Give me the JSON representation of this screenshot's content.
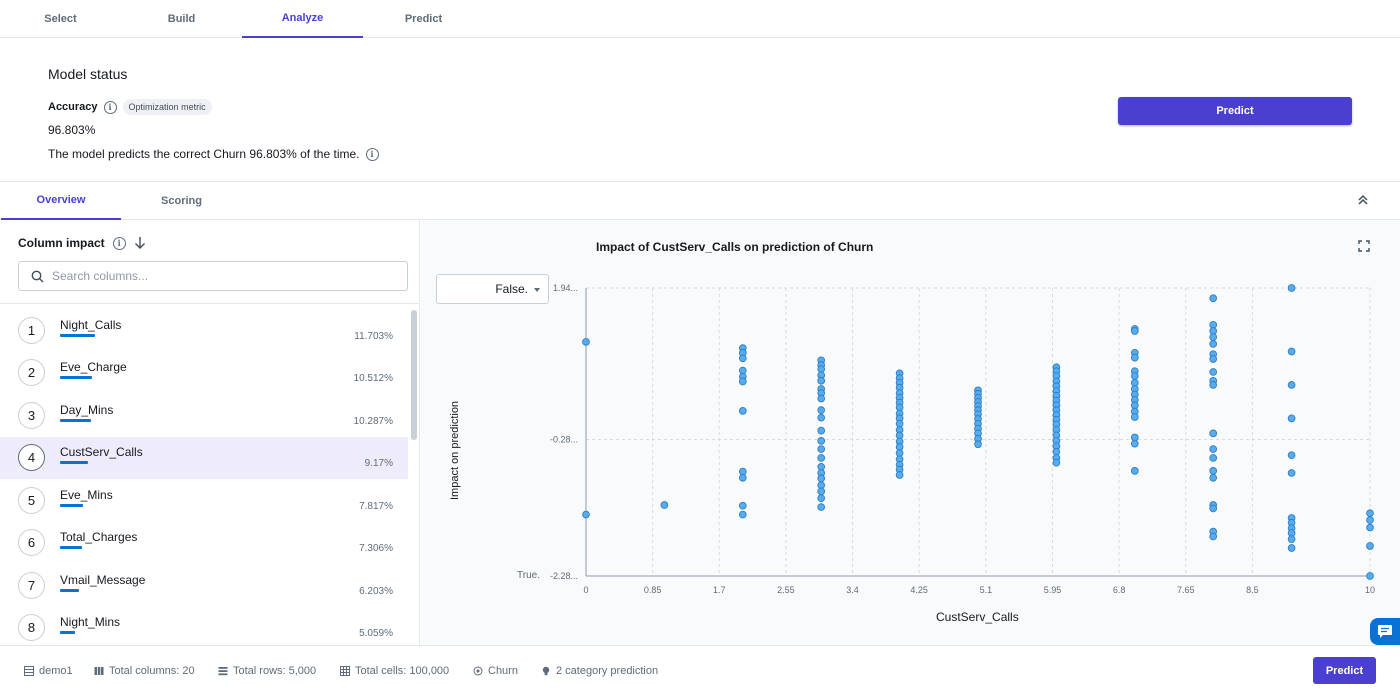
{
  "top_tabs": [
    {
      "label": "Select"
    },
    {
      "label": "Build"
    },
    {
      "label": "Analyze",
      "active": true
    },
    {
      "label": "Predict"
    }
  ],
  "model_status": {
    "title": "Model status",
    "accuracy_label": "Accuracy",
    "badge": "Optimization metric",
    "accuracy_value": "96.803%",
    "description": "The model predicts the correct Churn 96.803% of the time.",
    "predict_label": "Predict"
  },
  "sub_tabs": [
    {
      "label": "Overview",
      "active": true
    },
    {
      "label": "Scoring"
    }
  ],
  "column_impact": {
    "title": "Column impact",
    "search_placeholder": "Search columns...",
    "items": [
      {
        "rank": "1",
        "name": "Night_Calls",
        "pct": "11.703%",
        "bar": 0.117
      },
      {
        "rank": "2",
        "name": "Eve_Charge",
        "pct": "10.512%",
        "bar": 0.105
      },
      {
        "rank": "3",
        "name": "Day_Mins",
        "pct": "10.287%",
        "bar": 0.103
      },
      {
        "rank": "4",
        "name": "CustServ_Calls",
        "pct": "9.17%",
        "bar": 0.092,
        "selected": true
      },
      {
        "rank": "5",
        "name": "Eve_Mins",
        "pct": "7.817%",
        "bar": 0.078
      },
      {
        "rank": "6",
        "name": "Total_Charges",
        "pct": "7.306%",
        "bar": 0.073
      },
      {
        "rank": "7",
        "name": "Vmail_Message",
        "pct": "6.203%",
        "bar": 0.062
      },
      {
        "rank": "8",
        "name": "Night_Mins",
        "pct": "5.059%",
        "bar": 0.051
      }
    ]
  },
  "chart_data": {
    "type": "scatter",
    "title": "Impact of CustServ_Calls on prediction of Churn",
    "xlabel": "CustServ_Calls",
    "ylabel": "Impact on prediction",
    "class_select": "False.",
    "y_bottom_label": "True.",
    "xlim": [
      0,
      10
    ],
    "ylim": [
      -2.28,
      1.94
    ],
    "x_ticks": [
      "0",
      "0.85",
      "1.7",
      "2.55",
      "3.4",
      "4.25",
      "5.1",
      "5.95",
      "6.8",
      "7.65",
      "8.5",
      "10"
    ],
    "x_tick_values": [
      0,
      0.85,
      1.7,
      2.55,
      3.4,
      4.25,
      5.1,
      5.95,
      6.8,
      7.65,
      8.5,
      10
    ],
    "y_ticks": [
      "1.94...",
      "-0.28...",
      "-2.28..."
    ],
    "y_tick_values": [
      1.94,
      -0.28,
      -2.28
    ],
    "grid": true,
    "point_color": "#5aabea",
    "points": [
      [
        0,
        1.15
      ],
      [
        0,
        -1.38
      ],
      [
        1,
        -1.24
      ],
      [
        2,
        1.06
      ],
      [
        2,
        0.99
      ],
      [
        2,
        0.91
      ],
      [
        2,
        0.73
      ],
      [
        2,
        0.64
      ],
      [
        2,
        0.57
      ],
      [
        2,
        0.14
      ],
      [
        2,
        -0.75
      ],
      [
        2,
        -0.84
      ],
      [
        2,
        -1.25
      ],
      [
        2,
        -1.38
      ],
      [
        3,
        0.88
      ],
      [
        3,
        0.81
      ],
      [
        3,
        0.75
      ],
      [
        3,
        0.66
      ],
      [
        3,
        0.58
      ],
      [
        3,
        0.46
      ],
      [
        3,
        0.4
      ],
      [
        3,
        0.32
      ],
      [
        3,
        0.15
      ],
      [
        3,
        0.04
      ],
      [
        3,
        -0.15
      ],
      [
        3,
        -0.3
      ],
      [
        3,
        -0.42
      ],
      [
        3,
        -0.55
      ],
      [
        3,
        -0.68
      ],
      [
        3,
        -0.77
      ],
      [
        3,
        -0.85
      ],
      [
        3,
        -0.95
      ],
      [
        3,
        -1.04
      ],
      [
        3,
        -1.14
      ],
      [
        3,
        -1.27
      ],
      [
        4,
        0.69
      ],
      [
        4,
        0.62
      ],
      [
        4,
        0.55
      ],
      [
        4,
        0.48
      ],
      [
        4,
        0.4
      ],
      [
        4,
        0.33
      ],
      [
        4,
        0.26
      ],
      [
        4,
        0.19
      ],
      [
        4,
        0.1
      ],
      [
        4,
        0.03
      ],
      [
        4,
        -0.05
      ],
      [
        4,
        -0.14
      ],
      [
        4,
        -0.22
      ],
      [
        4,
        -0.31
      ],
      [
        4,
        -0.39
      ],
      [
        4,
        -0.48
      ],
      [
        4,
        -0.57
      ],
      [
        4,
        -0.65
      ],
      [
        4,
        -0.72
      ],
      [
        4,
        -0.8
      ],
      [
        5,
        0.44
      ],
      [
        5,
        0.39
      ],
      [
        5,
        0.33
      ],
      [
        5,
        0.27
      ],
      [
        5,
        0.21
      ],
      [
        5,
        0.15
      ],
      [
        5,
        0.09
      ],
      [
        5,
        0.02
      ],
      [
        5,
        -0.05
      ],
      [
        5,
        -0.12
      ],
      [
        5,
        -0.19
      ],
      [
        5,
        -0.27
      ],
      [
        5,
        -0.35
      ],
      [
        6,
        0.78
      ],
      [
        6,
        0.72
      ],
      [
        6,
        0.65
      ],
      [
        6,
        0.57
      ],
      [
        6,
        0.5
      ],
      [
        6,
        0.43
      ],
      [
        6,
        0.36
      ],
      [
        6,
        0.29
      ],
      [
        6,
        0.22
      ],
      [
        6,
        0.15
      ],
      [
        6,
        0.08
      ],
      [
        6,
        0.01
      ],
      [
        6,
        -0.06
      ],
      [
        6,
        -0.14
      ],
      [
        6,
        -0.22
      ],
      [
        6,
        -0.3
      ],
      [
        6,
        -0.38
      ],
      [
        6,
        -0.46
      ],
      [
        6,
        -0.55
      ],
      [
        6,
        -0.62
      ],
      [
        7,
        1.34
      ],
      [
        7,
        1.31
      ],
      [
        7,
        0.99
      ],
      [
        7,
        0.92
      ],
      [
        7,
        0.72
      ],
      [
        7,
        0.65
      ],
      [
        7,
        0.55
      ],
      [
        7,
        0.46
      ],
      [
        7,
        0.38
      ],
      [
        7,
        0.3
      ],
      [
        7,
        0.22
      ],
      [
        7,
        0.13
      ],
      [
        7,
        0.05
      ],
      [
        7,
        -0.25
      ],
      [
        7,
        -0.34
      ],
      [
        7,
        -0.74
      ],
      [
        8,
        1.79
      ],
      [
        8,
        1.4
      ],
      [
        8,
        1.31
      ],
      [
        8,
        1.22
      ],
      [
        8,
        1.12
      ],
      [
        8,
        0.97
      ],
      [
        8,
        0.9
      ],
      [
        8,
        0.71
      ],
      [
        8,
        0.58
      ],
      [
        8,
        0.52
      ],
      [
        8,
        -0.19
      ],
      [
        8,
        -0.42
      ],
      [
        8,
        -0.55
      ],
      [
        8,
        -0.74
      ],
      [
        8,
        -0.84
      ],
      [
        8,
        -1.24
      ],
      [
        8,
        -1.29
      ],
      [
        8,
        -1.63
      ],
      [
        8,
        -1.7
      ],
      [
        9,
        1.94
      ],
      [
        9,
        1.01
      ],
      [
        9,
        0.52
      ],
      [
        9,
        0.03
      ],
      [
        9,
        -0.51
      ],
      [
        9,
        -0.77
      ],
      [
        9,
        -1.43
      ],
      [
        9,
        -1.5
      ],
      [
        9,
        -1.58
      ],
      [
        9,
        -1.65
      ],
      [
        9,
        -1.74
      ],
      [
        9,
        -1.87
      ],
      [
        10,
        -1.36
      ],
      [
        10,
        -1.46
      ],
      [
        10,
        -1.57
      ],
      [
        10,
        -1.84
      ],
      [
        10,
        -2.28
      ]
    ]
  },
  "footer": {
    "dataset": "demo1",
    "total_columns": "Total columns: 20",
    "total_rows": "Total rows: 5,000",
    "total_cells": "Total cells: 100,000",
    "target": "Churn",
    "prediction_type": "2 category prediction",
    "predict_label": "Predict"
  },
  "icons": {
    "info": "info-icon",
    "sort": "arrow-down-icon",
    "search": "search-icon",
    "collapse": "double-chevron-up-icon",
    "expand": "fullscreen-icon",
    "chat": "chat-icon"
  },
  "colors": {
    "accent": "#4b3fcf",
    "bar": "#0972d3",
    "selected_row": "#eeecfb"
  }
}
